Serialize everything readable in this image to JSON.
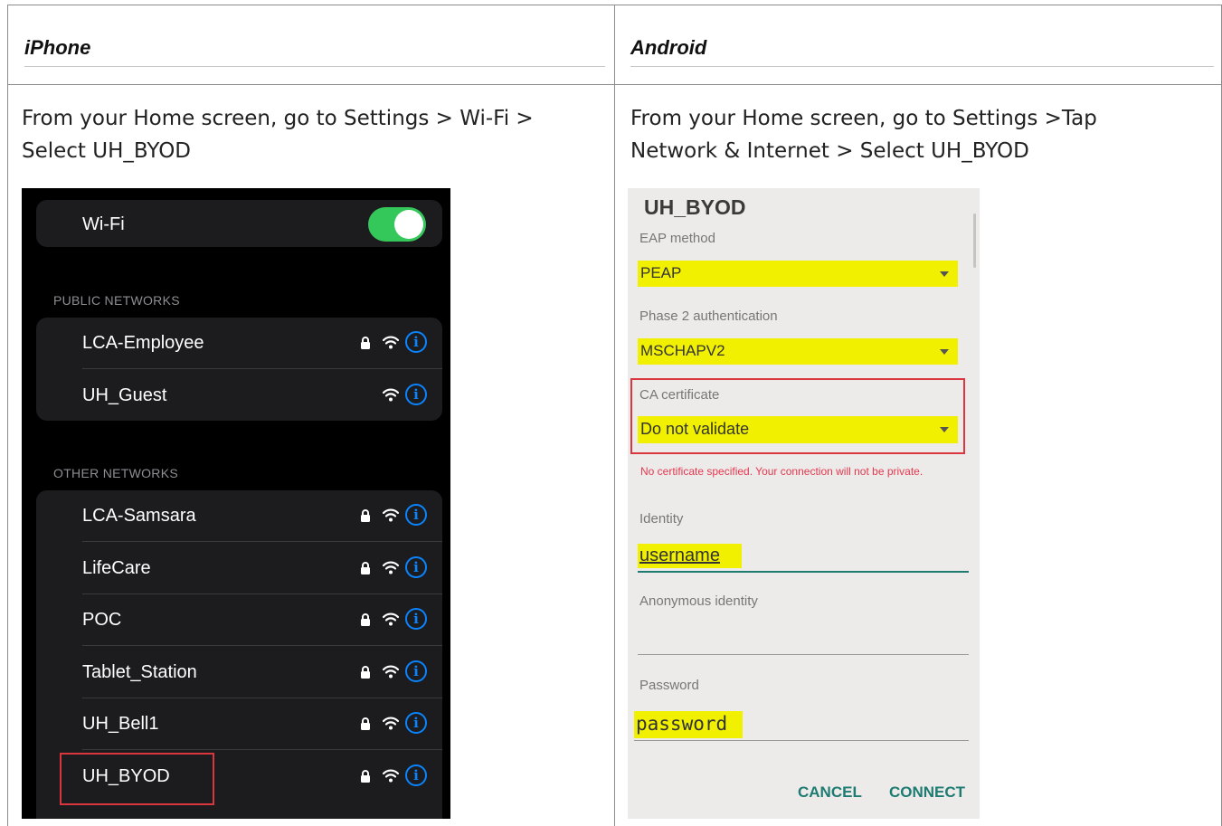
{
  "columns": {
    "left": {
      "heading": "iPhone",
      "instruction_line1": "From your Home screen, go to Settings > Wi-Fi >",
      "instruction_line2": "Select UH_BYOD"
    },
    "right": {
      "heading": "Android",
      "instruction_line1": "From your Home screen, go to Settings >Tap",
      "instruction_line2": "Network & Internet > Select UH_BYOD"
    }
  },
  "iphone": {
    "wifi_label": "Wi-Fi",
    "wifi_enabled": true,
    "public_header": "PUBLIC NETWORKS",
    "public_networks": [
      {
        "name": "LCA-Employee",
        "locked": true
      },
      {
        "name": "UH_Guest",
        "locked": false
      }
    ],
    "other_header": "OTHER NETWORKS",
    "other_networks": [
      {
        "name": "LCA-Samsara",
        "locked": true
      },
      {
        "name": "LifeCare",
        "locked": true
      },
      {
        "name": "POC",
        "locked": true
      },
      {
        "name": "Tablet_Station",
        "locked": true
      },
      {
        "name": "UH_Bell1",
        "locked": true
      },
      {
        "name": "UH_BYOD",
        "locked": true,
        "highlighted": true
      }
    ],
    "info_glyph": "i",
    "colors": {
      "toggle_on": "#34c759",
      "info_blue": "#0a84ff",
      "highlight_red": "#d9363e"
    }
  },
  "android": {
    "network_title": "UH_BYOD",
    "eap_label": "EAP method",
    "eap_value": "PEAP",
    "phase2_label": "Phase 2 authentication",
    "phase2_value": "MSCHAPV2",
    "ca_label": "CA certificate",
    "ca_value": "Do not validate",
    "ca_warning": "No certificate specified. Your connection will not be private.",
    "identity_label": "Identity",
    "identity_value": "username",
    "anon_label": "Anonymous identity",
    "anon_value": "",
    "password_label": "Password",
    "password_value": "password",
    "cancel_label": "CANCEL",
    "connect_label": "CONNECT",
    "colors": {
      "highlight_yellow": "#f0f000",
      "accent_teal": "#1d7b72",
      "error_red": "#e53950",
      "box_red": "#d9363e"
    }
  }
}
